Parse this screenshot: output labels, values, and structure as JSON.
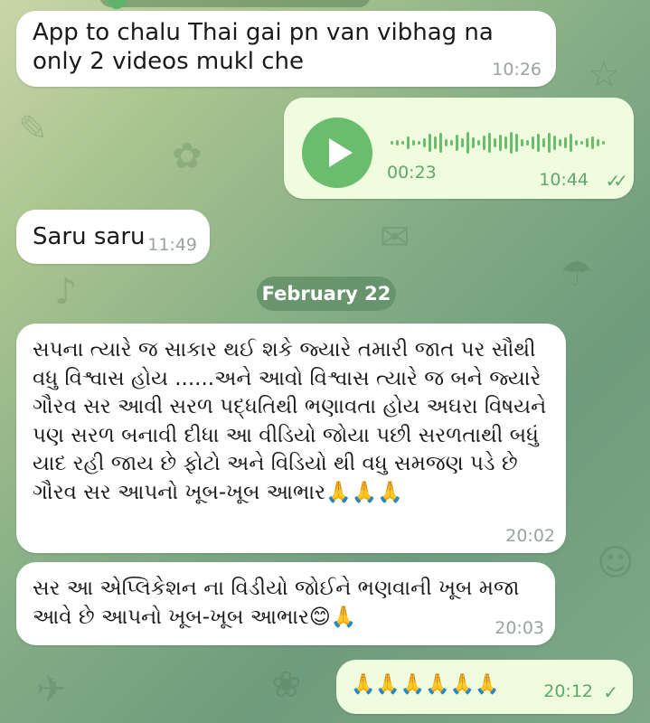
{
  "messages": [
    {
      "text": "App to chalu Thai gai pn van vibhag na only 2 videos mukl che",
      "time": "10:26"
    },
    {
      "voice": {
        "duration": "00:23"
      },
      "time": "10:44",
      "ticks": "✓✓"
    },
    {
      "text": "Saru saru",
      "time": "11:49"
    },
    {
      "text": "સપના ત્યારે જ સાકાર થઈ શકે જ્યારે તમારી જાત પર સૌથી વધુ વિશ્વાસ હોય ......અને આવો વિશ્વાસ ત્યારે જ બને જ્યારે ગૌરવ સર આવી સરળ પદ્ધતિથી ભણાવતા હોય અઘરા વિષયને પણ સરળ  બનાવી દીધા આ વીડિયો જોયા પછી સરળતાથી બધું યાદ રહી જાય છે ફોટો અને વિડિયો થી વધુ સમજણ પડે છે ગૌરવ સર આપનો ખૂબ-ખૂબ આભાર🙏🙏🙏",
      "time": "20:02"
    },
    {
      "text": "સર આ એપ્લિકેશન ના વિડીયો જોઈને ભણવાની ખૂબ મજા આવે છે આપનો ખૂબ-ખૂબ આભાર😊🙏",
      "time": "20:03"
    },
    {
      "text": "🙏🙏🙏🙏🙏🙏",
      "time": "20:12",
      "ticks": "✓"
    }
  ],
  "date_separator": "February 22",
  "colors": {
    "accent": "#6bbd6e",
    "outgoing": "#effdde",
    "incoming": "#ffffff"
  }
}
